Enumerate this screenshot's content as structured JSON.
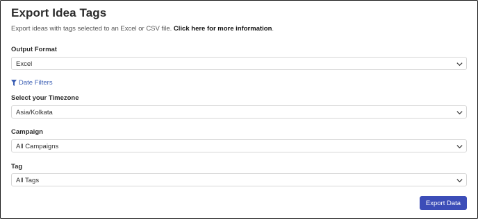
{
  "header": {
    "title": "Export Idea Tags",
    "subtitle": "Export ideas with tags selected to an Excel or CSV file.",
    "info_link": "Click here for more information",
    "subtitle_end": "."
  },
  "output_format": {
    "label": "Output Format",
    "value": "Excel"
  },
  "date_filters": {
    "label": "Date Filters",
    "icon": "filter-icon",
    "color": "#3c5fb4"
  },
  "timezone": {
    "label": "Select your Timezone",
    "value": "Asia/Kolkata"
  },
  "campaign": {
    "label": "Campaign",
    "value": "All Campaigns"
  },
  "tag": {
    "label": "Tag",
    "value": "All Tags"
  },
  "actions": {
    "export_label": "Export Data",
    "export_color": "#3c4db8"
  }
}
